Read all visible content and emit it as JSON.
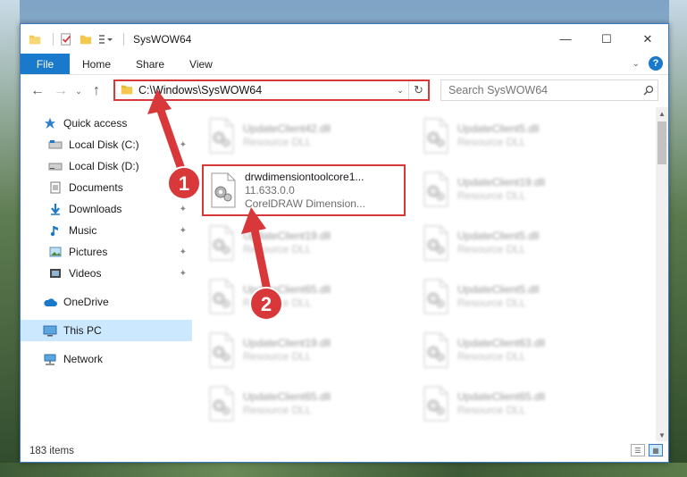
{
  "window": {
    "title": "SysWOW64",
    "minimize_glyph": "—",
    "maximize_glyph": "☐",
    "close_glyph": "✕"
  },
  "ribbon": {
    "tabs": [
      "File",
      "Home",
      "Share",
      "View"
    ],
    "help_glyph": "?",
    "collapse_glyph": "⌄"
  },
  "nav": {
    "back_glyph": "←",
    "forward_glyph": "→",
    "recent_glyph": "⌄",
    "up_glyph": "↑",
    "address_path": "C:\\Windows\\SysWOW64",
    "address_drop_glyph": "⌄",
    "refresh_glyph": "↻",
    "search_placeholder": "Search SysWOW64"
  },
  "sidebar": {
    "quick_access": "Quick access",
    "items": [
      {
        "label": "Local Disk (C:)",
        "icon": "drive-icon",
        "pinned": true
      },
      {
        "label": "Local Disk (D:)",
        "icon": "drive-icon",
        "pinned": false
      },
      {
        "label": "Documents",
        "icon": "documents-icon",
        "pinned": true
      },
      {
        "label": "Downloads",
        "icon": "download-icon",
        "pinned": true
      },
      {
        "label": "Music",
        "icon": "music-icon",
        "pinned": true
      },
      {
        "label": "Pictures",
        "icon": "pictures-icon",
        "pinned": true
      },
      {
        "label": "Videos",
        "icon": "videos-icon",
        "pinned": true
      }
    ],
    "onedrive": "OneDrive",
    "this_pc": "This PC",
    "network": "Network",
    "pin_glyph": "✦"
  },
  "files": [
    {
      "name": "UpdateClient42.dll",
      "desc": "Resource DLL"
    },
    {
      "name": "UpdateClient5.dll",
      "desc": "Resource DLL"
    },
    {
      "name": "drwdimensiontoolcore1...",
      "version": "11.633.0.0",
      "desc": "CorelDRAW Dimension..."
    },
    {
      "name": "UpdateClient19.dll",
      "desc": "Resource DLL"
    },
    {
      "name": "UpdateClient19.dll",
      "desc": "Resource DLL"
    },
    {
      "name": "UpdateClient5.dll",
      "desc": "Resource DLL"
    },
    {
      "name": "UpdateClient65.dll",
      "desc": "Resource DLL"
    },
    {
      "name": "UpdateClient5.dll",
      "desc": "Resource DLL"
    },
    {
      "name": "UpdateClient19.dll",
      "desc": "Resource DLL"
    },
    {
      "name": "UpdateClient63.dll",
      "desc": "Resource DLL"
    },
    {
      "name": "UpdateClient65.dll",
      "desc": "Resource DLL"
    },
    {
      "name": "UpdateClient65.dll",
      "desc": "Resource DLL"
    }
  ],
  "status": {
    "item_count": "183 items"
  },
  "annotations": {
    "step1": "1",
    "step2": "2",
    "color": "#d9383a"
  },
  "colors": {
    "accent": "#1979ca",
    "selection": "#cce8ff",
    "folder": "#f2c94c"
  }
}
